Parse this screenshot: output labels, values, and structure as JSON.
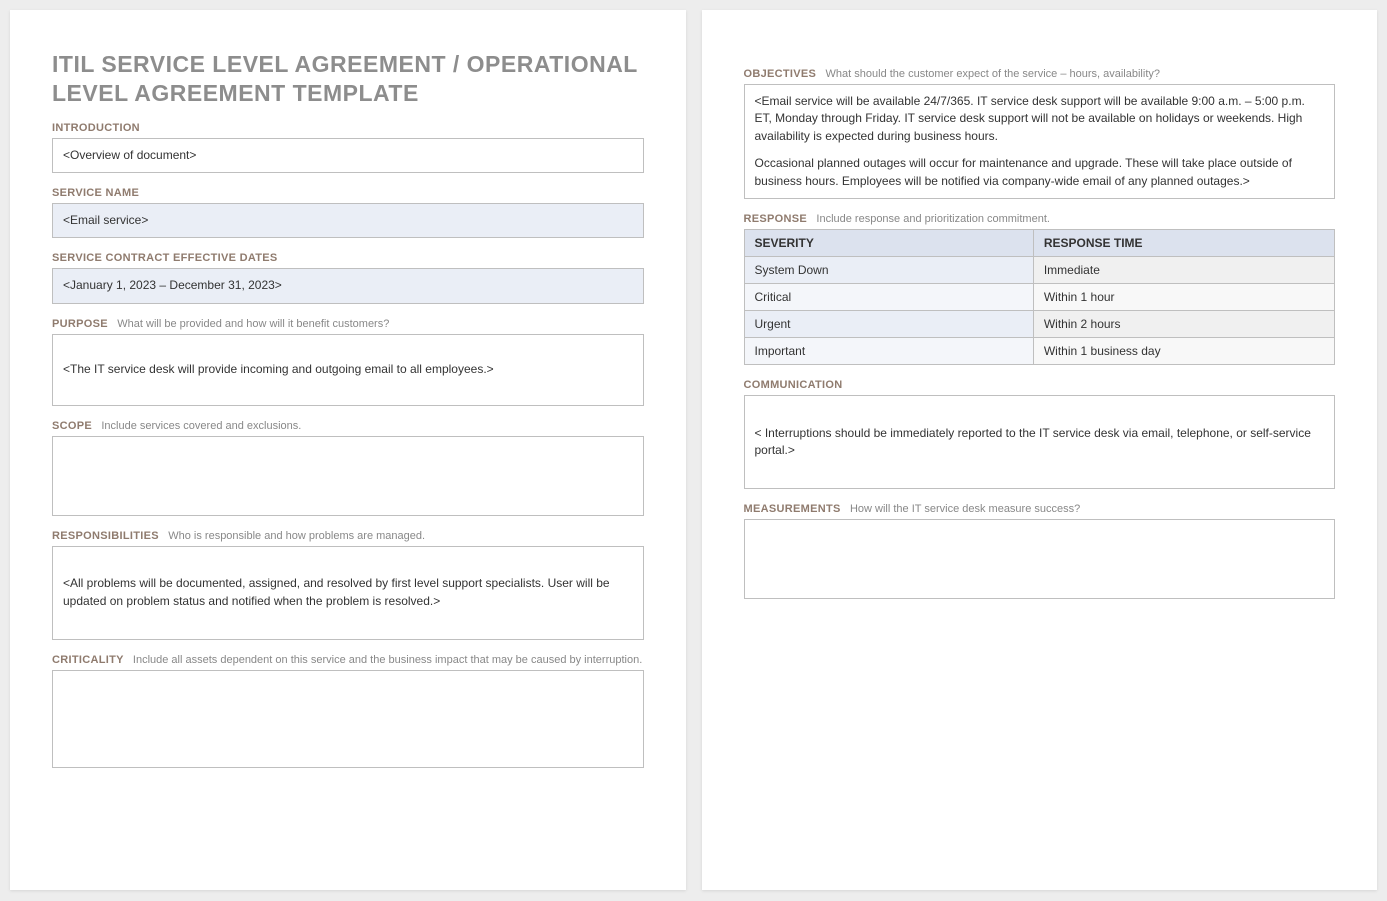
{
  "title": "ITIL SERVICE LEVEL AGREEMENT / OPERATIONAL LEVEL AGREEMENT TEMPLATE",
  "sections": {
    "introduction": {
      "label": "INTRODUCTION",
      "value": "<Overview of document>"
    },
    "service_name": {
      "label": "SERVICE NAME",
      "value": "<Email service>"
    },
    "effective_dates": {
      "label": "SERVICE CONTRACT EFFECTIVE DATES",
      "value": "<January 1, 2023 – December 31, 2023>"
    },
    "purpose": {
      "label": "PURPOSE",
      "hint": "What will be provided and how will it benefit customers?",
      "value": "<The IT service desk will provide incoming and outgoing email to all employees.>"
    },
    "scope": {
      "label": "SCOPE",
      "hint": "Include services covered and exclusions.",
      "value": ""
    },
    "responsibilities": {
      "label": "RESPONSIBILITIES",
      "hint": "Who is responsible and how problems are managed.",
      "value": "<All problems will be documented, assigned, and resolved by first level support specialists. User will be updated on problem status and notified when the problem is resolved.>"
    },
    "criticality": {
      "label": "CRITICALITY",
      "hint": "Include all assets dependent on this service and the business impact that may be caused by interruption.",
      "value": ""
    },
    "objectives": {
      "label": "OBJECTIVES",
      "hint": "What should the customer expect of the service – hours, availability?",
      "para1": "<Email service will be available 24/7/365. IT service desk support will be available 9:00 a.m. – 5:00 p.m. ET, Monday through Friday. IT service desk support will not be available on holidays or weekends. High availability is expected during business hours.",
      "para2": "Occasional planned outages will occur for maintenance and upgrade. These will take place outside of business hours. Employees will be notified via company-wide email of any planned outages.>"
    },
    "response": {
      "label": "RESPONSE",
      "hint": "Include response and prioritization commitment.",
      "headers": {
        "severity": "SEVERITY",
        "time": "RESPONSE TIME"
      },
      "rows": [
        {
          "severity": "System Down",
          "time": "Immediate"
        },
        {
          "severity": "Critical",
          "time": "Within 1 hour"
        },
        {
          "severity": "Urgent",
          "time": "Within 2 hours"
        },
        {
          "severity": "Important",
          "time": "Within 1 business day"
        }
      ]
    },
    "communication": {
      "label": "COMMUNICATION",
      "value": "< Interruptions should be immediately reported to the IT service desk via email, telephone, or self-service portal.>"
    },
    "measurements": {
      "label": "MEASUREMENTS",
      "hint": "How will the IT service desk measure success?",
      "value": ""
    }
  }
}
